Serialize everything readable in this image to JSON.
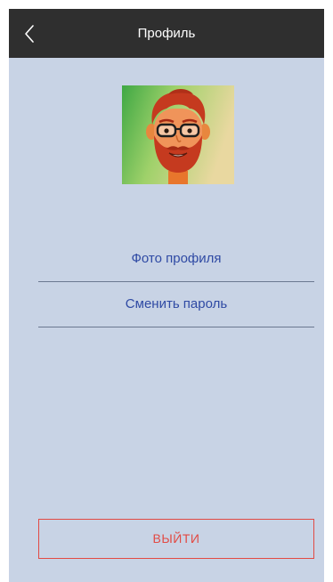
{
  "header": {
    "title": "Профиль",
    "back_icon": "chevron-left-icon"
  },
  "avatar": {
    "icon": "bearded-man-with-glasses-avatar"
  },
  "menu": {
    "items": [
      {
        "label": "Фото профиля"
      },
      {
        "label": "Сменить пароль"
      }
    ]
  },
  "logout": {
    "label": "ВЫЙТИ"
  },
  "colors": {
    "header_bg": "#2f2f2f",
    "screen_bg": "#c8d3e5",
    "link": "#2f4aa4",
    "danger": "#e24a44"
  }
}
